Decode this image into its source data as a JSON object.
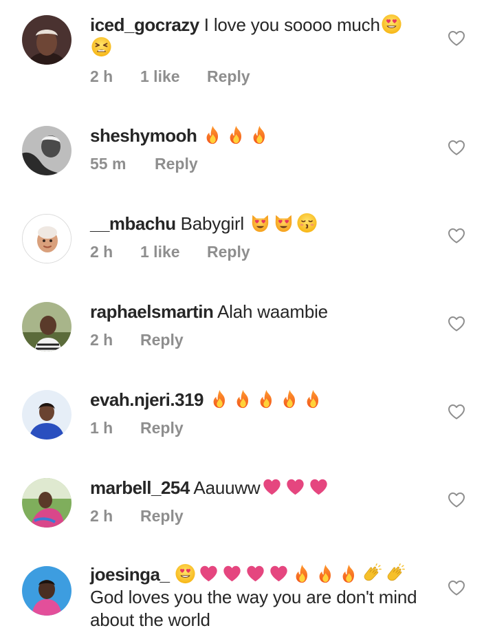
{
  "comments": [
    {
      "username": "iced_gocrazy",
      "text": "I love you soooo much",
      "emojis": [
        "heart-eyes-emoji",
        "tired-face-emoji"
      ],
      "time": "2 h",
      "likes": "1 like",
      "reply": "Reply"
    },
    {
      "username": "sheshymooh",
      "text": "",
      "emojis": [
        "fire-emoji",
        "fire-emoji",
        "fire-emoji"
      ],
      "time": "55 m",
      "reply": "Reply"
    },
    {
      "username": "__mbachu",
      "text": "Babygirl",
      "emojis": [
        "heart-eyes-cat-emoji",
        "heart-eyes-cat-emoji",
        "kissing-closed-eyes-emoji"
      ],
      "time": "2 h",
      "likes": "1 like",
      "reply": "Reply"
    },
    {
      "username": "raphaelsmartin",
      "text": "Alah waambie",
      "emojis": [],
      "time": "2 h",
      "reply": "Reply"
    },
    {
      "username": "evah.njeri.319",
      "text": "",
      "emojis": [
        "fire-emoji",
        "fire-emoji",
        "fire-emoji",
        "fire-emoji",
        "fire-emoji"
      ],
      "time": "1 h",
      "reply": "Reply"
    },
    {
      "username": "marbell_254",
      "text": "Aauuww",
      "emojis": [
        "pink-heart-emoji",
        "pink-heart-emoji",
        "pink-heart-emoji"
      ],
      "time": "2 h",
      "reply": "Reply"
    },
    {
      "username": "joesinga_",
      "text": "God loves you the way you are don't mind about the world",
      "emojis": [
        "heart-eyes-emoji",
        "pink-heart-emoji",
        "pink-heart-emoji",
        "pink-heart-emoji",
        "pink-heart-emoji",
        "fire-emoji",
        "fire-emoji",
        "fire-emoji",
        "clapping-hands-emoji",
        "clapping-hands-emoji"
      ]
    }
  ],
  "colors": {
    "username": "#262626",
    "meta": "#8e8e8e",
    "heart_outline": "#8e8e8e",
    "background": "#ffffff"
  },
  "icons": {
    "like": "heart-outline-icon"
  }
}
